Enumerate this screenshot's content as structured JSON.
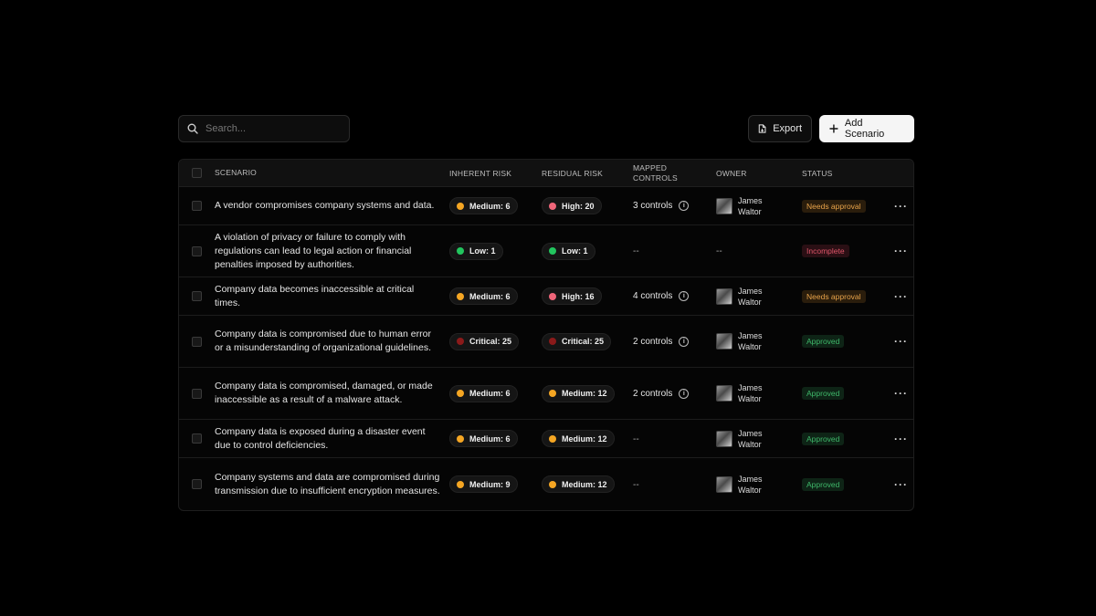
{
  "search": {
    "placeholder": "Search..."
  },
  "actions": {
    "export_label": "Export",
    "add_label": "Add Scenario"
  },
  "columns": {
    "scenario": "SCENARIO",
    "inherent": "INHERENT RISK",
    "residual": "RESIDUAL RISK",
    "mapped_1": "MAPPED",
    "mapped_2": "CONTROLS",
    "owner": "OWNER",
    "status": "STATUS"
  },
  "colors": {
    "medium": "#f5a623",
    "high": "#f0667a",
    "low": "#22c55e",
    "critical": "#8b1a1a",
    "needs_approval_text": "#e8a34a",
    "needs_approval_bg": "#2a1d0c",
    "incomplete_text": "#e0566a",
    "incomplete_bg": "#2a0f14",
    "approved_text": "#3fb86a",
    "approved_bg": "#0e2416"
  },
  "rows": [
    {
      "scenario": "A vendor compromises company systems and data.",
      "inherent": "Medium: 6",
      "inherent_level": "medium",
      "residual": "High: 20",
      "residual_level": "high",
      "controls": "3 controls",
      "owner_first": "James",
      "owner_last": "Waltor",
      "status": "Needs approval",
      "status_kind": "needs_approval"
    },
    {
      "scenario": "A violation of privacy or failure to comply with regulations can lead to legal action or financial penalties imposed by authorities.",
      "inherent": "Low: 1",
      "inherent_level": "low",
      "residual": "Low: 1",
      "residual_level": "low",
      "controls": "--",
      "owner_first": "",
      "owner_last": "",
      "owner_dash": "--",
      "status": "Incomplete",
      "status_kind": "incomplete"
    },
    {
      "scenario": "Company data becomes inaccessible at critical times.",
      "inherent": "Medium: 6",
      "inherent_level": "medium",
      "residual": "High: 16",
      "residual_level": "high",
      "controls": "4 controls",
      "owner_first": "James",
      "owner_last": "Waltor",
      "status": "Needs approval",
      "status_kind": "needs_approval"
    },
    {
      "scenario": "Company data is compromised due to human error or a misunderstanding of organizational guidelines.",
      "inherent": "Critical: 25",
      "inherent_level": "critical",
      "residual": "Critical: 25",
      "residual_level": "critical",
      "controls": "2 controls",
      "owner_first": "James",
      "owner_last": "Waltor",
      "status": "Approved",
      "status_kind": "approved"
    },
    {
      "scenario": "Company data is compromised, damaged, or made inaccessible as a result of a malware attack.",
      "inherent": "Medium: 6",
      "inherent_level": "medium",
      "residual": "Medium: 12",
      "residual_level": "medium",
      "controls": "2 controls",
      "owner_first": "James",
      "owner_last": "Waltor",
      "status": "Approved",
      "status_kind": "approved"
    },
    {
      "scenario": "Company data is exposed during a disaster event due to control deficiencies.",
      "inherent": "Medium: 6",
      "inherent_level": "medium",
      "residual": "Medium: 12",
      "residual_level": "medium",
      "controls": "--",
      "owner_first": "James",
      "owner_last": "Waltor",
      "status": "Approved",
      "status_kind": "approved"
    },
    {
      "scenario": "Company systems and data are compromised during transmission due to insufficient encryption measures.",
      "inherent": "Medium: 9",
      "inherent_level": "medium",
      "residual": "Medium: 12",
      "residual_level": "medium",
      "controls": "--",
      "owner_first": "James",
      "owner_last": "Waltor",
      "status": "Approved",
      "status_kind": "approved"
    }
  ]
}
